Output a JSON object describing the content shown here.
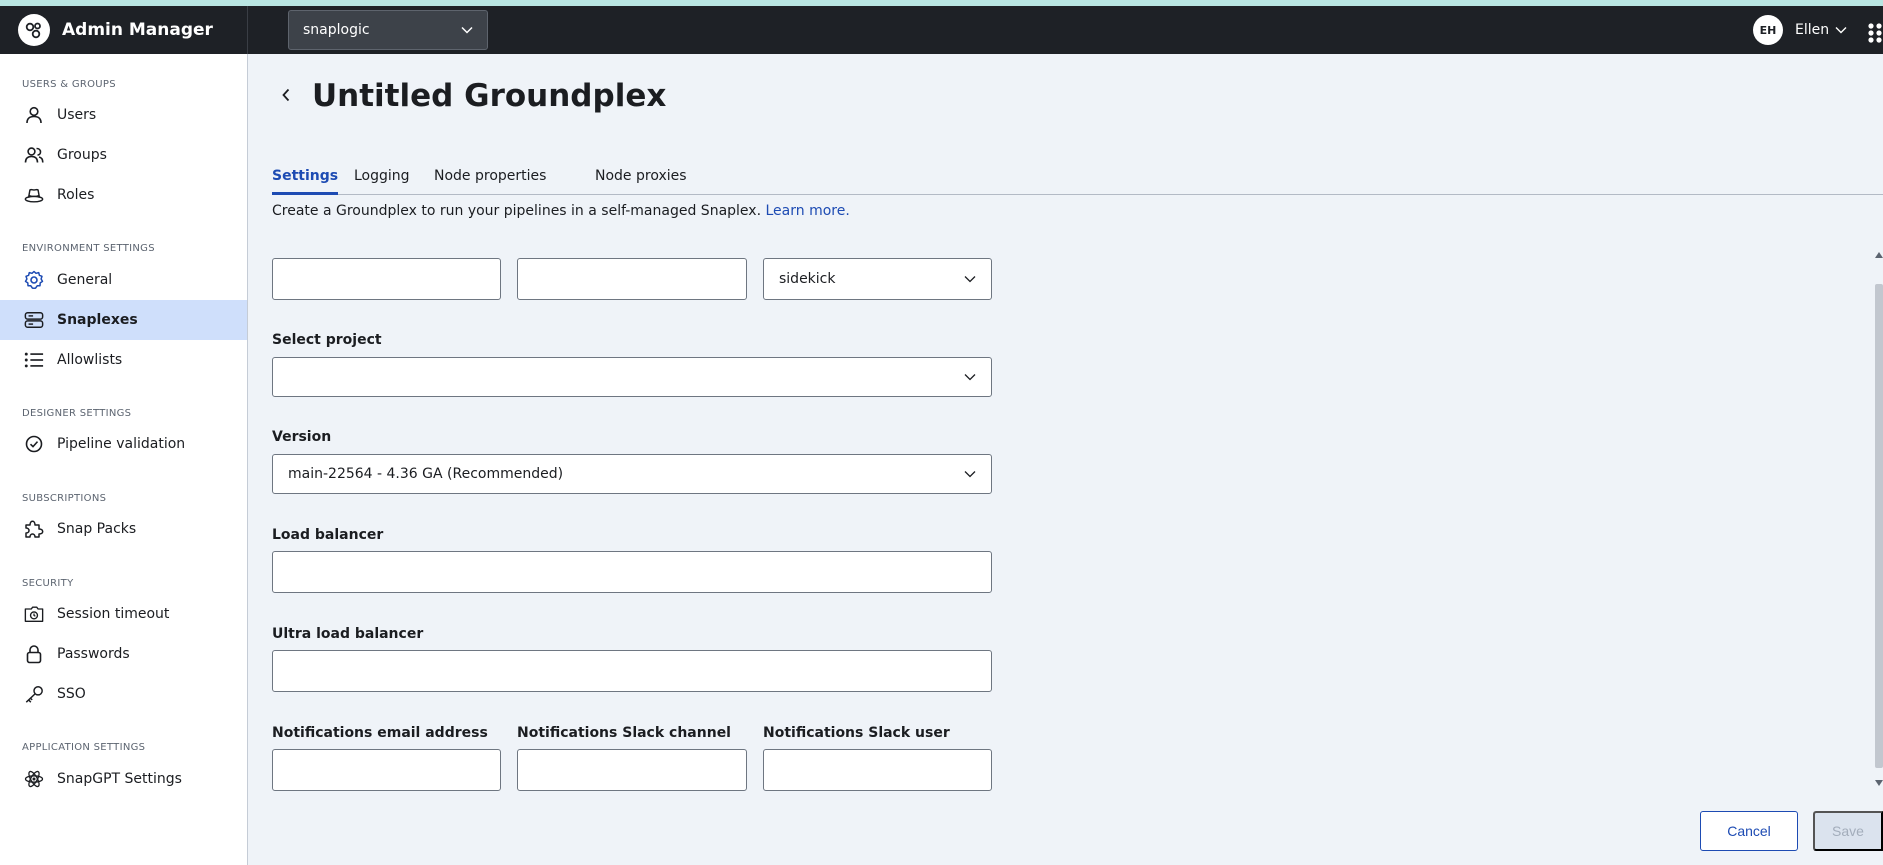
{
  "app": {
    "title": "Admin Manager",
    "org": "snaplogic"
  },
  "user": {
    "initials": "EH",
    "name": "Ellen"
  },
  "sidebar": {
    "sections": [
      {
        "title": "USERS & GROUPS",
        "items": [
          {
            "label": "Users",
            "icon": "user-icon"
          },
          {
            "label": "Groups",
            "icon": "users-icon"
          },
          {
            "label": "Roles",
            "icon": "hat-icon"
          }
        ]
      },
      {
        "title": "ENVIRONMENT SETTINGS",
        "items": [
          {
            "label": "General",
            "icon": "gear-icon"
          },
          {
            "label": "Snaplexes",
            "icon": "server-icon",
            "active": true
          },
          {
            "label": "Allowlists",
            "icon": "list-icon"
          }
        ]
      },
      {
        "title": "DESIGNER SETTINGS",
        "items": [
          {
            "label": "Pipeline validation",
            "icon": "check-circle-icon"
          }
        ]
      },
      {
        "title": "SUBSCRIPTIONS",
        "items": [
          {
            "label": "Snap Packs",
            "icon": "puzzle-icon"
          }
        ]
      },
      {
        "title": "SECURITY",
        "items": [
          {
            "label": "Session timeout",
            "icon": "timeout-icon"
          },
          {
            "label": "Passwords",
            "icon": "lock-icon"
          },
          {
            "label": "SSO",
            "icon": "key-icon"
          }
        ]
      },
      {
        "title": "APPLICATION SETTINGS",
        "items": [
          {
            "label": "SnapGPT Settings",
            "icon": "atom-icon"
          }
        ]
      }
    ]
  },
  "page": {
    "title": "Untitled Groundplex",
    "tabs": [
      {
        "label": "Settings",
        "active": true
      },
      {
        "label": "Logging"
      },
      {
        "label": "Node properties"
      },
      {
        "label": "Node proxies"
      }
    ],
    "description": "Create a Groundplex to run your pipelines in a self-managed Snaplex.",
    "learn_more": "Learn more."
  },
  "form": {
    "name_value": "",
    "location_value": "",
    "type_value": "sidekick",
    "project_label": "Select project",
    "project_value": "",
    "version_label": "Version",
    "version_value": "main-22564 - 4.36 GA (Recommended)",
    "load_balancer_label": "Load balancer",
    "load_balancer_value": "",
    "ultra_lb_label": "Ultra load balancer",
    "ultra_lb_value": "",
    "notify_email_label": "Notifications email address",
    "notify_email_value": "",
    "notify_slack_channel_label": "Notifications Slack channel",
    "notify_slack_channel_value": "",
    "notify_slack_user_label": "Notifications Slack user",
    "notify_slack_user_value": ""
  },
  "actions": {
    "cancel": "Cancel",
    "save": "Save"
  },
  "colors": {
    "accent": "#1d4bb3",
    "topbar": "#1e2126",
    "active_nav": "#cfdffb"
  }
}
